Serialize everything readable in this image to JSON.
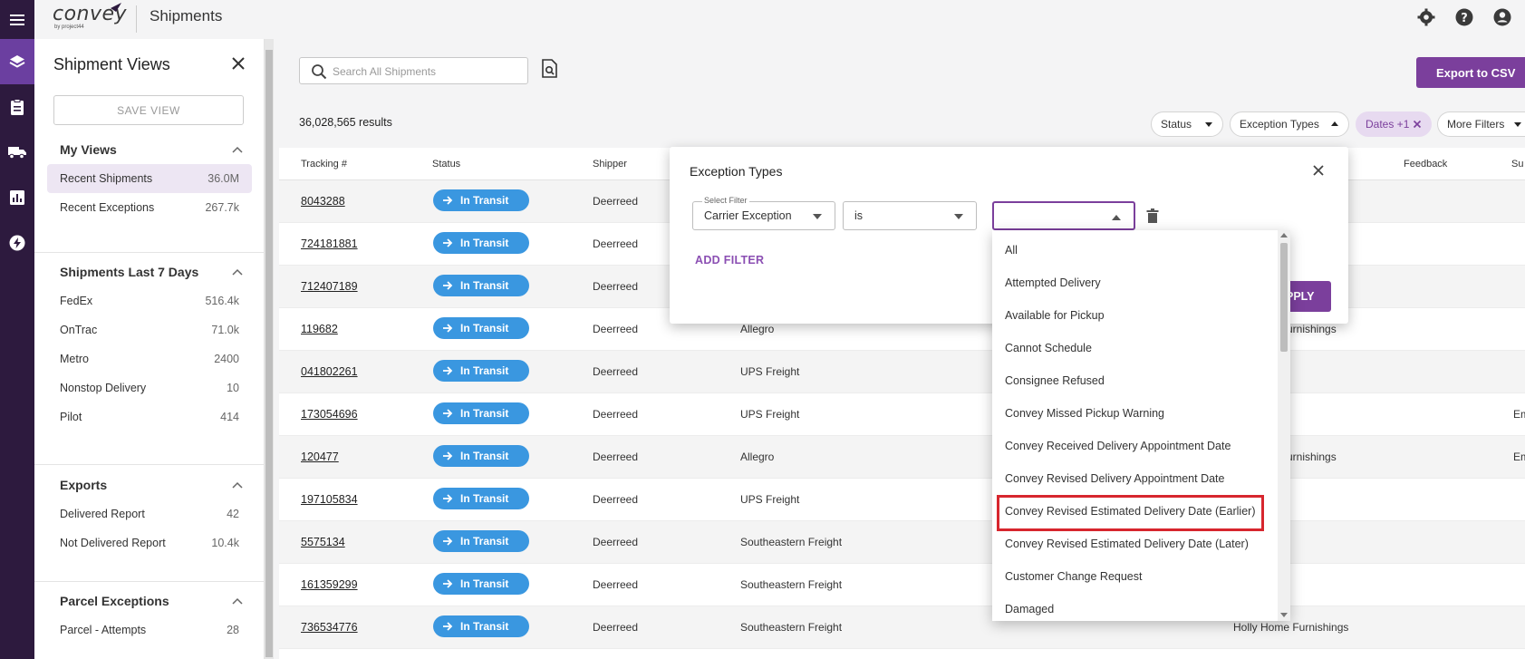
{
  "app": {
    "logo": "convey",
    "logo_sub": "by project44",
    "page_title": "Shipments"
  },
  "sidepanel": {
    "title": "Shipment Views",
    "save_view": "SAVE VIEW",
    "sections": [
      {
        "title": "My Views",
        "items": [
          {
            "label": "Recent Shipments",
            "count": "36.0M"
          },
          {
            "label": "Recent Exceptions",
            "count": "267.7k"
          }
        ]
      },
      {
        "title": "Shipments Last 7 Days",
        "items": [
          {
            "label": "FedEx",
            "count": "516.4k"
          },
          {
            "label": "OnTrac",
            "count": "71.0k"
          },
          {
            "label": "Metro",
            "count": "2400"
          },
          {
            "label": "Nonstop Delivery",
            "count": "10"
          },
          {
            "label": "Pilot",
            "count": "414"
          }
        ]
      },
      {
        "title": "Exports",
        "items": [
          {
            "label": "Delivered Report",
            "count": "42"
          },
          {
            "label": "Not Delivered Report",
            "count": "10.4k"
          }
        ]
      },
      {
        "title": "Parcel Exceptions",
        "items": [
          {
            "label": "Parcel - Attempts",
            "count": "28"
          }
        ]
      }
    ]
  },
  "search": {
    "placeholder": "Search All Shipments"
  },
  "results": "36,028,565 results",
  "export_label": "Export to CSV",
  "chips": {
    "status": "Status",
    "exception_types": "Exception Types",
    "dates": "Dates +1",
    "more_filters": "More Filters"
  },
  "table": {
    "headers": {
      "tracking": "Tracking #",
      "status": "Status",
      "shipper": "Shipper",
      "feedback": "Feedback",
      "sub": "Su"
    },
    "rows": [
      {
        "tracking": "8043288",
        "status": "In Transit",
        "shipper": "Deerreed",
        "carrier": "",
        "customer": "",
        "extra": ""
      },
      {
        "tracking": "724181881",
        "status": "In Transit",
        "shipper": "Deerreed",
        "carrier": "",
        "customer": "",
        "extra": ""
      },
      {
        "tracking": "712407189",
        "status": "In Transit",
        "shipper": "Deerreed",
        "carrier": "",
        "customer": "",
        "extra": ""
      },
      {
        "tracking": "119682",
        "status": "In Transit",
        "shipper": "Deerreed",
        "carrier": "Allegro",
        "customer": "urnishings",
        "extra": ""
      },
      {
        "tracking": "041802261",
        "status": "In Transit",
        "shipper": "Deerreed",
        "carrier": "UPS Freight",
        "customer": "",
        "extra": ""
      },
      {
        "tracking": "173054696",
        "status": "In Transit",
        "shipper": "Deerreed",
        "carrier": "UPS Freight",
        "customer": "",
        "extra": "Em"
      },
      {
        "tracking": "120477",
        "status": "In Transit",
        "shipper": "Deerreed",
        "carrier": "Allegro",
        "customer": "urnishings",
        "extra": "Em"
      },
      {
        "tracking": "197105834",
        "status": "In Transit",
        "shipper": "Deerreed",
        "carrier": "UPS Freight",
        "customer": "",
        "extra": ""
      },
      {
        "tracking": "5575134",
        "status": "In Transit",
        "shipper": "Deerreed",
        "carrier": "Southeastern Freight",
        "customer": "",
        "extra": ""
      },
      {
        "tracking": "161359299",
        "status": "In Transit",
        "shipper": "Deerreed",
        "carrier": "Southeastern Freight",
        "customer": "",
        "extra": ""
      },
      {
        "tracking": "736534776",
        "status": "In Transit",
        "shipper": "Deerreed",
        "carrier": "Southeastern Freight",
        "customer": "Holly Home Furnishings",
        "extra": ""
      }
    ]
  },
  "popup": {
    "title": "Exception Types",
    "select_filter_legend": "Select Filter",
    "select_filter_value": "Carrier Exception",
    "operator": "is",
    "value": "",
    "add_filter": "ADD FILTER",
    "apply": "PPLY"
  },
  "dropdown": {
    "options": [
      "All",
      "Attempted Delivery",
      "Available for Pickup",
      "Cannot Schedule",
      "Consignee Refused",
      "Convey Missed Pickup Warning",
      "Convey Received Delivery Appointment Date",
      "Convey Revised Delivery Appointment Date",
      "Convey Revised Estimated Delivery Date (Earlier)",
      "Convey Revised Estimated Delivery Date (Later)",
      "Customer Change Request",
      "Damaged"
    ],
    "highlighted": "Convey Revised Estimated Delivery Date (Earlier)"
  },
  "colors": {
    "brand": "#7b3f9c",
    "rail": "#2d1a3e",
    "status_blue": "#3a97e0",
    "highlight": "#d7262e"
  }
}
